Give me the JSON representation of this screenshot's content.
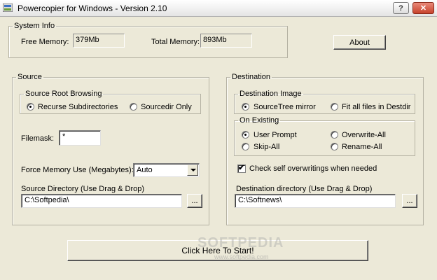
{
  "window": {
    "title": "Powercopier for Windows - Version 2.10",
    "help_label": "?",
    "close_label": "✕"
  },
  "system_info": {
    "legend": "System Info",
    "free_memory_label": "Free Memory:",
    "free_memory_value": "379Mb",
    "total_memory_label": "Total Memory:",
    "total_memory_value": "893Mb"
  },
  "about_button": "About",
  "source": {
    "legend": "Source",
    "root_browsing": {
      "legend": "Source Root Browsing",
      "option_recurse": "Recurse Subdirectories",
      "option_sourcedir": "Sourcedir Only",
      "selected": "recurse"
    },
    "filemask_label": "Filemask:",
    "filemask_value": "*",
    "force_memory_label": "Force Memory Use (Megabytes):",
    "force_memory_value": "Auto",
    "directory_label": "Source Directory (Use Drag & Drop)",
    "directory_value": "C:\\Softpedia\\",
    "browse_label": "..."
  },
  "destination": {
    "legend": "Destination",
    "image": {
      "legend": "Destination Image",
      "option_sourcetree": "SourceTree mirror",
      "option_fitall": "Fit all files in Destdir",
      "selected": "sourcetree"
    },
    "on_existing": {
      "legend": "On Existing",
      "option_user_prompt": "User Prompt",
      "option_overwrite_all": "Overwrite-All",
      "option_skip_all": "Skip-All",
      "option_rename_all": "Rename-All",
      "selected": "user_prompt"
    },
    "check_self_overwrite_label": "Check self overwritings when needed",
    "check_self_overwrite_checked": true,
    "directory_label": "Destination directory (Use Drag & Drop)",
    "directory_value": "C:\\Softnews\\",
    "browse_label": "..."
  },
  "start_button": "Click Here To Start!",
  "watermark": {
    "text": "SOFTPEDIA",
    "sub": "www.softpedia.com"
  }
}
